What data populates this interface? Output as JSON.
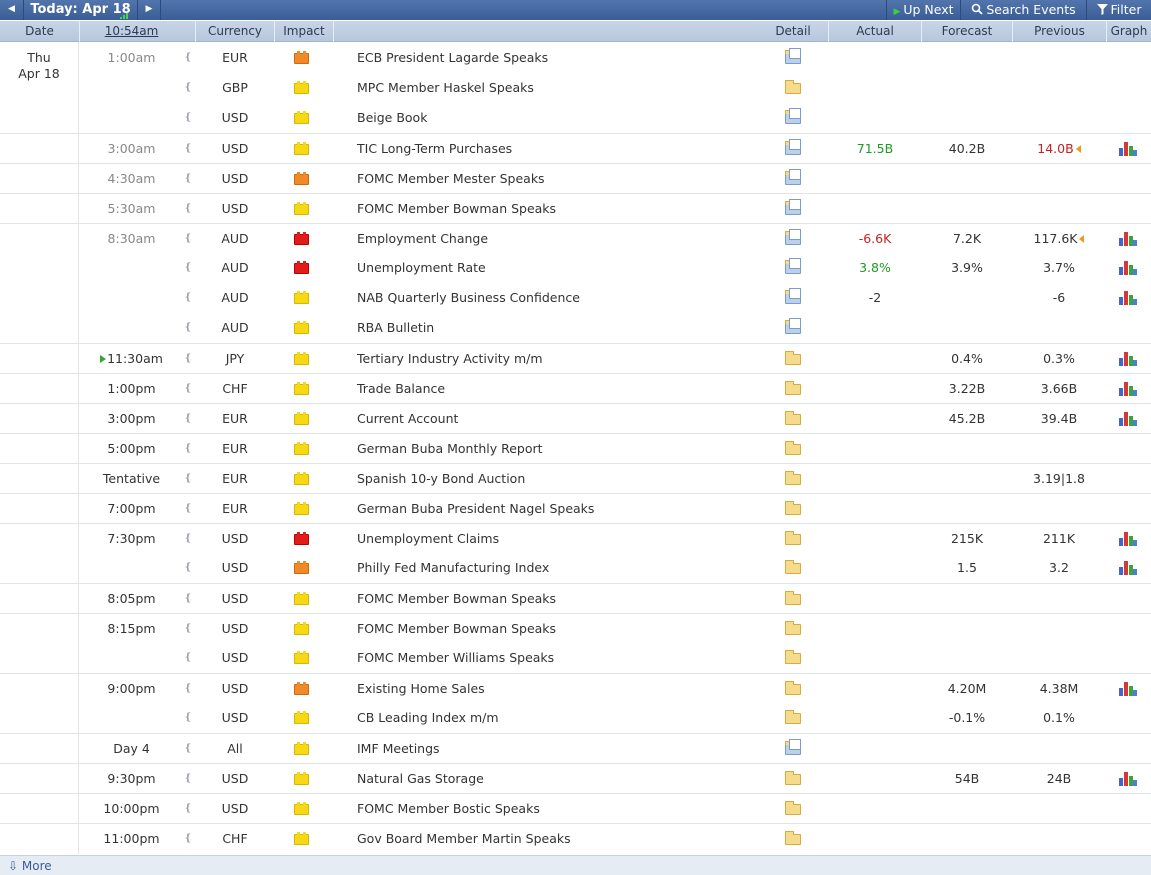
{
  "toolbar": {
    "prev_icon": "left-arrow-icon",
    "today_label": "Today: Apr 18",
    "next_icon": "right-arrow-icon",
    "up_next_label": "Up Next",
    "search_label": "Search Events",
    "filter_label": "Filter"
  },
  "columns": {
    "date": "Date",
    "time": "10:54am",
    "currency": "Currency",
    "impact": "Impact",
    "detail": "Detail",
    "actual": "Actual",
    "forecast": "Forecast",
    "previous": "Previous",
    "graph": "Graph"
  },
  "day": {
    "weekday": "Thu",
    "date": "Apr 18"
  },
  "impact_colors": {
    "high": "#e21b1b",
    "medium": "#f08a28",
    "low": "#f6d814"
  },
  "value_colors": {
    "better": "#219a21",
    "worse": "#cc1f1f"
  },
  "events": [
    {
      "time": "1:00am",
      "past": true,
      "currency": "EUR",
      "impact": "orange",
      "event": "ECB President Lagarde Speaks",
      "detail_icon": "doc",
      "actual": "",
      "forecast": "",
      "previous": "",
      "graph": false
    },
    {
      "time": "",
      "past": true,
      "currency": "GBP",
      "impact": "yellow",
      "event": "MPC Member Haskel Speaks",
      "detail_icon": "folder",
      "actual": "",
      "forecast": "",
      "previous": "",
      "graph": false
    },
    {
      "time": "",
      "past": true,
      "currency": "USD",
      "impact": "yellow",
      "event": "Beige Book",
      "detail_icon": "doc",
      "actual": "",
      "forecast": "",
      "previous": "",
      "graph": false
    },
    {
      "time": "3:00am",
      "past": true,
      "currency": "USD",
      "impact": "yellow",
      "event": "TIC Long-Term Purchases",
      "detail_icon": "doc",
      "actual": "71.5B",
      "actual_color": "green",
      "forecast": "40.2B",
      "previous": "14.0B",
      "previous_color": "red",
      "previous_revised": true,
      "graph": true
    },
    {
      "time": "4:30am",
      "past": true,
      "currency": "USD",
      "impact": "orange",
      "event": "FOMC Member Mester Speaks",
      "detail_icon": "doc",
      "actual": "",
      "forecast": "",
      "previous": "",
      "graph": false
    },
    {
      "time": "5:30am",
      "past": true,
      "currency": "USD",
      "impact": "yellow",
      "event": "FOMC Member Bowman Speaks",
      "detail_icon": "doc",
      "actual": "",
      "forecast": "",
      "previous": "",
      "graph": false
    },
    {
      "time": "8:30am",
      "past": true,
      "currency": "AUD",
      "impact": "red",
      "event": "Employment Change",
      "detail_icon": "doc",
      "actual": "-6.6K",
      "actual_color": "red",
      "forecast": "7.2K",
      "previous": "117.6K",
      "previous_revised": true,
      "graph": true
    },
    {
      "time": "",
      "past": true,
      "currency": "AUD",
      "impact": "red",
      "event": "Unemployment Rate",
      "detail_icon": "doc",
      "actual": "3.8%",
      "actual_color": "green",
      "forecast": "3.9%",
      "previous": "3.7%",
      "graph": true
    },
    {
      "time": "",
      "past": true,
      "currency": "AUD",
      "impact": "yellow",
      "event": "NAB Quarterly Business Confidence",
      "detail_icon": "doc",
      "actual": "-2",
      "forecast": "",
      "previous": "-6",
      "graph": true
    },
    {
      "time": "",
      "past": true,
      "currency": "AUD",
      "impact": "yellow",
      "event": "RBA Bulletin",
      "detail_icon": "doc",
      "actual": "",
      "forecast": "",
      "previous": "",
      "graph": false
    },
    {
      "time": "11:30am",
      "past": false,
      "upnext": true,
      "currency": "JPY",
      "impact": "yellow",
      "event": "Tertiary Industry Activity m/m",
      "detail_icon": "folder",
      "actual": "",
      "forecast": "0.4%",
      "previous": "0.3%",
      "graph": true
    },
    {
      "time": "1:00pm",
      "past": false,
      "currency": "CHF",
      "impact": "yellow",
      "event": "Trade Balance",
      "detail_icon": "folder",
      "actual": "",
      "forecast": "3.22B",
      "previous": "3.66B",
      "graph": true
    },
    {
      "time": "3:00pm",
      "past": false,
      "currency": "EUR",
      "impact": "yellow",
      "event": "Current Account",
      "detail_icon": "folder",
      "actual": "",
      "forecast": "45.2B",
      "previous": "39.4B",
      "graph": true
    },
    {
      "time": "5:00pm",
      "past": false,
      "currency": "EUR",
      "impact": "yellow",
      "event": "German Buba Monthly Report",
      "detail_icon": "folder",
      "actual": "",
      "forecast": "",
      "previous": "",
      "graph": false
    },
    {
      "time": "Tentative",
      "past": false,
      "currency": "EUR",
      "impact": "yellow",
      "event": "Spanish 10-y Bond Auction",
      "detail_icon": "folder",
      "actual": "",
      "forecast": "",
      "previous": "3.19|1.8",
      "graph": false
    },
    {
      "time": "7:00pm",
      "past": false,
      "currency": "EUR",
      "impact": "yellow",
      "event": "German Buba President Nagel Speaks",
      "detail_icon": "folder",
      "actual": "",
      "forecast": "",
      "previous": "",
      "graph": false
    },
    {
      "time": "7:30pm",
      "past": false,
      "currency": "USD",
      "impact": "red",
      "event": "Unemployment Claims",
      "detail_icon": "folder",
      "actual": "",
      "forecast": "215K",
      "previous": "211K",
      "graph": true
    },
    {
      "time": "",
      "past": false,
      "currency": "USD",
      "impact": "orange",
      "event": "Philly Fed Manufacturing Index",
      "detail_icon": "folder",
      "actual": "",
      "forecast": "1.5",
      "previous": "3.2",
      "graph": true
    },
    {
      "time": "8:05pm",
      "past": false,
      "currency": "USD",
      "impact": "yellow",
      "event": "FOMC Member Bowman Speaks",
      "detail_icon": "folder",
      "actual": "",
      "forecast": "",
      "previous": "",
      "graph": false
    },
    {
      "time": "8:15pm",
      "past": false,
      "currency": "USD",
      "impact": "yellow",
      "event": "FOMC Member Bowman Speaks",
      "detail_icon": "folder",
      "actual": "",
      "forecast": "",
      "previous": "",
      "graph": false
    },
    {
      "time": "",
      "past": false,
      "currency": "USD",
      "impact": "yellow",
      "event": "FOMC Member Williams Speaks",
      "detail_icon": "folder",
      "actual": "",
      "forecast": "",
      "previous": "",
      "graph": false
    },
    {
      "time": "9:00pm",
      "past": false,
      "currency": "USD",
      "impact": "orange",
      "event": "Existing Home Sales",
      "detail_icon": "folder",
      "actual": "",
      "forecast": "4.20M",
      "previous": "4.38M",
      "graph": true
    },
    {
      "time": "",
      "past": false,
      "currency": "USD",
      "impact": "yellow",
      "event": "CB Leading Index m/m",
      "detail_icon": "folder",
      "actual": "",
      "forecast": "-0.1%",
      "previous": "0.1%",
      "graph": false
    },
    {
      "time": "Day 4",
      "past": false,
      "currency": "All",
      "impact": "yellow",
      "event": "IMF Meetings",
      "detail_icon": "doc",
      "actual": "",
      "forecast": "",
      "previous": "",
      "graph": false
    },
    {
      "time": "9:30pm",
      "past": false,
      "currency": "USD",
      "impact": "yellow",
      "event": "Natural Gas Storage",
      "detail_icon": "folder",
      "actual": "",
      "forecast": "54B",
      "previous": "24B",
      "graph": true
    },
    {
      "time": "10:00pm",
      "past": false,
      "currency": "USD",
      "impact": "yellow",
      "event": "FOMC Member Bostic Speaks",
      "detail_icon": "folder",
      "actual": "",
      "forecast": "",
      "previous": "",
      "graph": false
    },
    {
      "time": "11:00pm",
      "past": false,
      "currency": "CHF",
      "impact": "yellow",
      "event": "Gov Board Member Martin Speaks",
      "detail_icon": "folder",
      "actual": "",
      "forecast": "",
      "previous": "",
      "graph": false
    }
  ],
  "footer": {
    "more_label": "More"
  }
}
